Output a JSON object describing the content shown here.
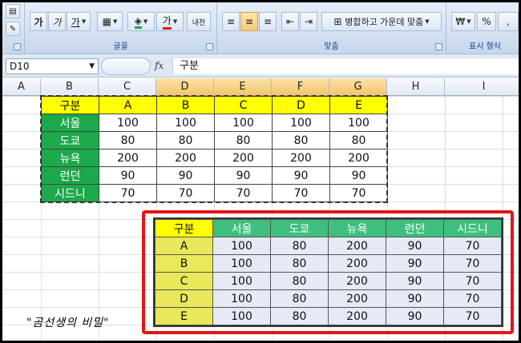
{
  "ribbon": {
    "font_group_label": "글꼴",
    "align_group_label": "맞춤",
    "number_group_label": "표시 형식",
    "bold_label": "가",
    "italic_label": "가",
    "underline_label": "가",
    "font_color_label": "가",
    "phonetic_label": "내천",
    "merge_label": "병합하고 가운데 맞춤",
    "currency_label": "₩",
    "percent_label": "%",
    "comma_label": ","
  },
  "formula_bar": {
    "name_box": "D10",
    "fx_label": "fx",
    "formula": "구분"
  },
  "columns": [
    "A",
    "B",
    "C",
    "D",
    "E",
    "F",
    "G",
    "H",
    "I"
  ],
  "table1": {
    "header": [
      "구분",
      "A",
      "B",
      "C",
      "D",
      "E"
    ],
    "rows": [
      [
        "서울",
        "100",
        "100",
        "100",
        "100",
        "100"
      ],
      [
        "도쿄",
        "80",
        "80",
        "80",
        "80",
        "80"
      ],
      [
        "뉴욕",
        "200",
        "200",
        "200",
        "200",
        "200"
      ],
      [
        "런던",
        "90",
        "90",
        "90",
        "90",
        "90"
      ],
      [
        "시드니",
        "70",
        "70",
        "70",
        "70",
        "70"
      ]
    ]
  },
  "table2": {
    "header": [
      "구분",
      "서울",
      "도쿄",
      "뉴욕",
      "런던",
      "시드니"
    ],
    "rows": [
      [
        "A",
        "100",
        "80",
        "200",
        "90",
        "70"
      ],
      [
        "B",
        "100",
        "80",
        "200",
        "90",
        "70"
      ],
      [
        "C",
        "100",
        "80",
        "200",
        "90",
        "70"
      ],
      [
        "D",
        "100",
        "80",
        "200",
        "90",
        "70"
      ],
      [
        "E",
        "100",
        "80",
        "200",
        "90",
        "70"
      ]
    ]
  },
  "watermark": "\"곰선생의 비밀\"",
  "colors": {
    "header_yellow": "#ffff00",
    "label_green": "#1da84a",
    "highlight_red": "#e11616"
  }
}
